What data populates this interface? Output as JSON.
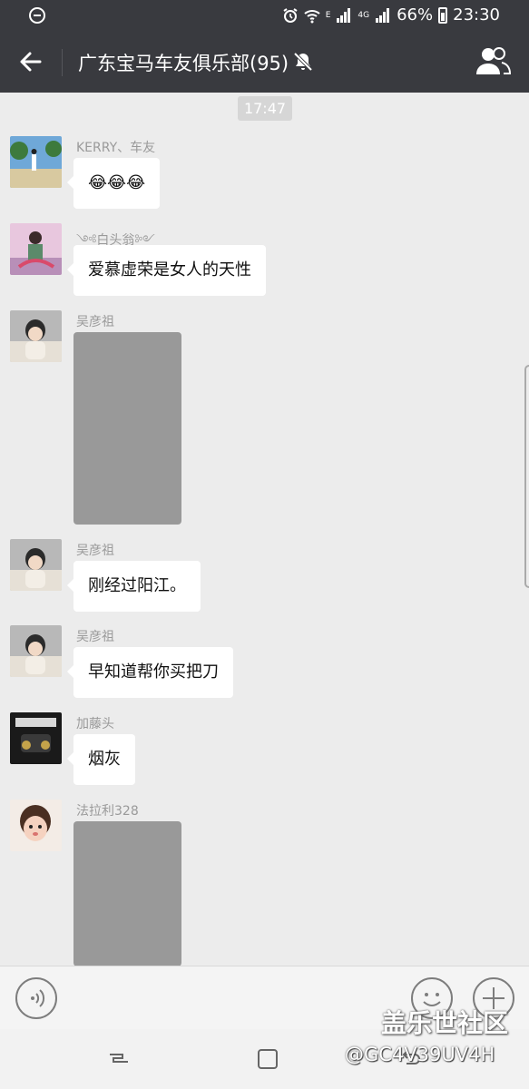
{
  "status_bar": {
    "battery": "66%",
    "time": "23:30",
    "network": "4G",
    "signal_tag": "E"
  },
  "header": {
    "title": "广东宝马车友俱乐部(95)",
    "back_icon": "back-arrow-icon",
    "mute_icon": "bell-off-icon",
    "members_icon": "group-icon"
  },
  "chat": {
    "timestamp": "17:47",
    "messages": [
      {
        "sender": "KERRY、车友",
        "text": "😂😂😂",
        "type": "text"
      },
      {
        "sender": "༺白头翁༻",
        "text": "爱慕虚荣是女人的天性",
        "type": "text"
      },
      {
        "sender": "吴彦祖",
        "type": "image"
      },
      {
        "sender": "吴彦祖",
        "text": "刚经过阳江。",
        "type": "text"
      },
      {
        "sender": "吴彦祖",
        "text": "早知道帮你买把刀",
        "type": "text"
      },
      {
        "sender": "加藤头",
        "text": "烟灰",
        "type": "text"
      },
      {
        "sender": "法拉利328",
        "type": "image"
      }
    ]
  },
  "watermark": {
    "site": "盖乐世社区",
    "user": "@GC4V39UV4H"
  },
  "colors": {
    "header_bg": "#393a3f",
    "chat_bg": "#ececec",
    "bubble_bg": "#ffffff",
    "image_placeholder": "#999999"
  }
}
